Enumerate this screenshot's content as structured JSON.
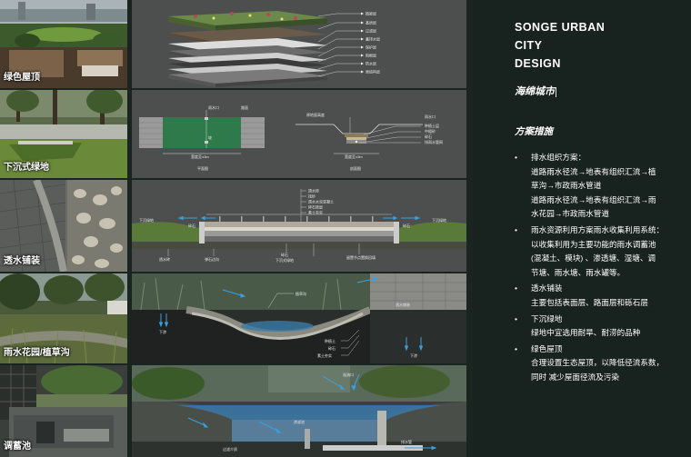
{
  "sidebar": {
    "brand_lines": [
      "SONGE URBAN",
      "CITY",
      "DESIGN"
    ],
    "subtitle": "海绵城市",
    "section_title": "方案措施",
    "measures": [
      {
        "lines": [
          "排水组织方案：",
          "道路雨水径流→地表有组织汇流→植",
          "草沟→市政雨水管道",
          "道路雨水径流→地表有组织汇流→雨",
          "水花园→市政雨水管道"
        ]
      },
      {
        "lines": [
          "雨水资源利用方案雨水收集利用系统：",
          "以收集利用为主要功能的雨水调蓄池",
          "(混凝土、模块) 、渗透塘、湿塘、调",
          "节塘、雨水塘、雨水罐等。"
        ]
      },
      {
        "lines": [
          "透水铺装",
          "主要包括表面层、路面层和砾石层"
        ]
      },
      {
        "lines": [
          "下沉绿地",
          "绿地中宜选用耐旱、耐涝的品种"
        ]
      },
      {
        "lines": [
          "绿色屋顶",
          "合理设置生态屋顶，以降低径流系数，",
          "同时 减少屋面径流及污染"
        ]
      }
    ]
  },
  "photos": [
    {
      "label": "绿色屋顶"
    },
    {
      "label": "下沉式绿地"
    },
    {
      "label": "透水铺装"
    },
    {
      "label": "雨水花园/植草沟"
    },
    {
      "label": "调蓄池"
    }
  ],
  "diagrams": {
    "roof_layers": [
      "植被层",
      "基质层",
      "过滤层",
      "蓄排水层",
      "保护层",
      "阻根层",
      "防水层",
      "原结构层"
    ],
    "sunken": {
      "plan_labels": [
        "雨水口",
        "路面",
        "坡",
        "宽度至±3m",
        "平面图"
      ],
      "section_labels": [
        "原地面高度",
        "雨水口",
        "种植土层",
        "中粗砂",
        "碎石",
        "排雨水管网",
        "宽度至±3m",
        "剖面图"
      ]
    },
    "paving": {
      "top_labels": [
        "透水砖",
        "找砂",
        "透水水泥混凝土",
        "碎石垫层",
        "素土夯实"
      ],
      "side_labels": [
        "下沉绿地",
        "碎石",
        "碎石",
        "下沉绿地"
      ],
      "bottom_labels": [
        "透水砖",
        "弹石边沟",
        "碎石",
        "下沉式绿地",
        "留置节点置换回填"
      ]
    },
    "rain_garden": [
      "植草沟",
      "透水铺装",
      "下渗",
      "种植土",
      "碎石",
      "素土夯实",
      "下渗"
    ],
    "storage": [
      "渗滤池",
      "过滤介质",
      "排水管",
      "溢流口"
    ]
  }
}
